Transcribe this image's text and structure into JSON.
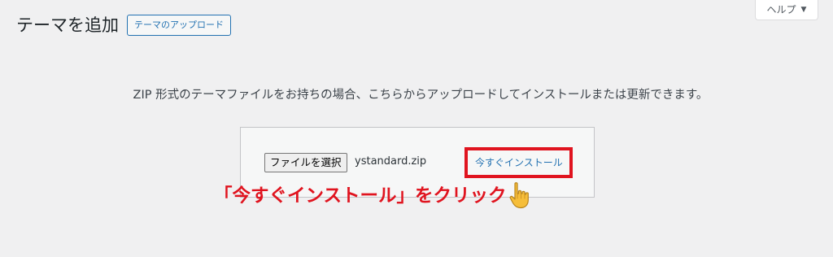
{
  "header": {
    "title": "テーマを追加",
    "upload_button_label": "テーマのアップロード",
    "help_tab_label": "ヘルプ",
    "help_caret": "▼"
  },
  "upload": {
    "description": "ZIP 形式のテーマファイルをお持ちの場合、こちらからアップロードしてインストールまたは更新できます。",
    "file_button_label": "ファイルを選択",
    "selected_file_name": "ystandard.zip",
    "install_button_label": "今すぐインストール"
  },
  "annotation": {
    "text": "「今すぐインストール」をクリック",
    "color": "#e0141f",
    "icon": "pointing-hand-icon"
  },
  "colors": {
    "background": "#f0f0f1",
    "accent": "#2271b1",
    "highlight": "#e0141f"
  }
}
